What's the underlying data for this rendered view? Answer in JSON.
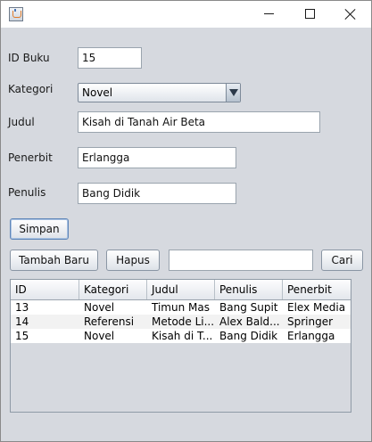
{
  "window": {
    "title": "",
    "minimize_label": "",
    "maximize_label": "",
    "close_label": ""
  },
  "form": {
    "id_label": "ID Buku",
    "id_value": "15",
    "kategori_label": "Kategori",
    "kategori_value": "Novel",
    "judul_label": "Judul",
    "judul_value": "Kisah di Tanah Air Beta",
    "penerbit_label": "Penerbit",
    "penerbit_value": "Erlangga",
    "penulis_label": "Penulis",
    "penulis_value": "Bang Didik",
    "simpan_label": "Simpan"
  },
  "toolbar": {
    "tambah_label": "Tambah Baru",
    "hapus_label": "Hapus",
    "search_value": "",
    "cari_label": "Cari"
  },
  "table": {
    "columns": [
      "ID",
      "Kategori",
      "Judul",
      "Penulis",
      "Penerbit"
    ],
    "rows": [
      [
        "13",
        "Novel",
        "Timun Mas",
        "Bang Supit",
        "Elex Media"
      ],
      [
        "14",
        "Referensi",
        "Metode Li...",
        "Alex Bald...",
        "Springer"
      ],
      [
        "15",
        "Novel",
        "Kisah di T...",
        "Bang Didik",
        "Erlangga"
      ]
    ]
  },
  "colors": {
    "window_bg": "#d6d9df",
    "row_even": "#f2f2f2",
    "row_odd": "#ffffff"
  },
  "icons": {
    "app": "java-app-icon",
    "minimize": "minimize-icon",
    "maximize": "maximize-icon",
    "close": "close-icon",
    "dropdown": "chevron-down-icon"
  }
}
